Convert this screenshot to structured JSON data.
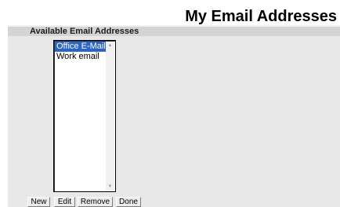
{
  "page": {
    "title": "My Email Addresses"
  },
  "section": {
    "header": "Available Email Addresses"
  },
  "email_list": {
    "items": [
      {
        "label": "Office E-Mail",
        "selected": true
      },
      {
        "label": "Work email",
        "selected": false
      }
    ]
  },
  "buttons": {
    "new_label": "New",
    "edit_label": "Edit",
    "remove_label": "Remove",
    "done_label": "Done"
  },
  "colors": {
    "selection": "#2a64c5",
    "panel_background": "#e8e8e8",
    "header_background": "#d4d4d4"
  }
}
